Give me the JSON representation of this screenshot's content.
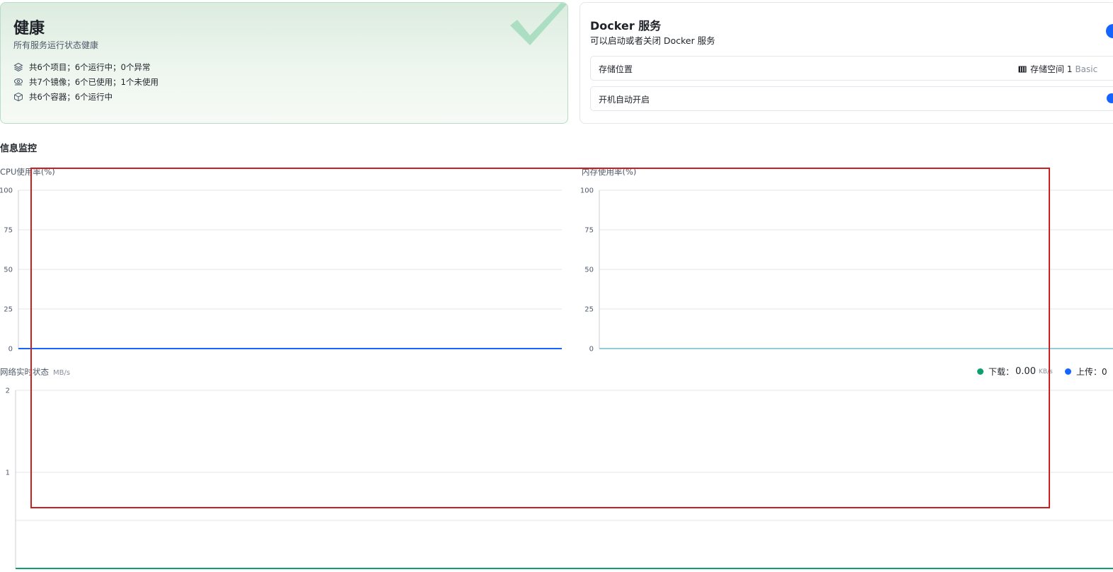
{
  "health": {
    "title": "健康",
    "subtitle": "所有服务运行状态健康",
    "stats": [
      {
        "icon": "layers-icon",
        "text": "共6个项目；6个运行中；0个异常"
      },
      {
        "icon": "image-icon",
        "text": "共7个镜像；6个已使用；1个未使用"
      },
      {
        "icon": "container-box-icon",
        "text": "共6个容器；6个运行中"
      }
    ],
    "badge_icon": "checkmark-icon",
    "badge_color": "#a8dcc0"
  },
  "docker": {
    "title": "Docker 服务",
    "subtitle": "可以启动或者关闭 Docker 服务",
    "storage_label": "存储位置",
    "storage_value": "存储空间 1",
    "storage_tag": "Basic",
    "autostart_label": "开机自动开启",
    "toggle_color": "#1664ff"
  },
  "monitor": {
    "section_title": "信息监控",
    "cpu_title": "CPU使用率(%)",
    "mem_title": "内存使用率(%)",
    "net_title": "网络实时状态",
    "net_unit": "MB/s",
    "download_label": "下载：",
    "download_value": "0.00",
    "download_unit": "KB/s",
    "upload_label": "上传：0",
    "download_color": "#0e9f6e",
    "upload_color": "#1664ff"
  },
  "chart_data": [
    {
      "type": "line",
      "ylabel": "CPU使用率(%)",
      "ylim": [
        0,
        100
      ],
      "yticks": [
        "0",
        "25",
        "50",
        "75",
        "100"
      ],
      "series": [
        {
          "values": [
            0,
            0
          ],
          "color": "#1664ff"
        }
      ],
      "grid": true
    },
    {
      "type": "line",
      "ylabel": "内存使用率(%)",
      "ylim": [
        0,
        100
      ],
      "yticks": [
        "0",
        "25",
        "50",
        "75",
        "100"
      ],
      "series": [
        {
          "values": [
            0,
            0
          ],
          "color": "#8fd0d8"
        }
      ],
      "grid": true
    },
    {
      "type": "line",
      "ylabel": "网络实时状态 MB/s",
      "yticks": [
        "1",
        "2"
      ],
      "series": [
        {
          "values": [
            0,
            0
          ],
          "color": "#0e9f6e"
        }
      ],
      "grid": true
    }
  ]
}
